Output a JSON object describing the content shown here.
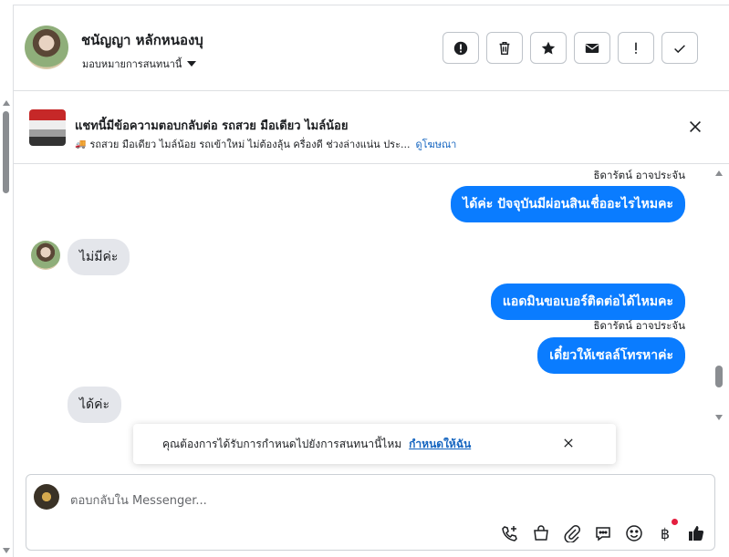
{
  "header": {
    "contact_name": "ชนัญญา หลักหนองบุ",
    "assign_label": "มอบหมายการสนทนานี้",
    "actions": [
      {
        "name": "spam-button",
        "icon": "alert-circle-icon"
      },
      {
        "name": "delete-button",
        "icon": "trash-icon"
      },
      {
        "name": "star-button",
        "icon": "star-icon"
      },
      {
        "name": "mark-unread-button",
        "icon": "envelope-icon"
      },
      {
        "name": "follow-up-button",
        "icon": "exclamation-icon"
      },
      {
        "name": "done-button",
        "icon": "check-icon"
      }
    ]
  },
  "ad": {
    "title": "แชทนี้มีข้อความตอบกลับต่อ รถสวย มือเดียว ไมล์น้อย",
    "description": "รถสวย มือเดียว ไมล์น้อย รถเข้าใหม่ ไม่ต้องลุ้น ครื่องดี ช่วงล่างแน่น ประ...",
    "link_label": "ดูโฆษณา"
  },
  "messages": {
    "sender_1": "ธิดารัตน์ อาจประจัน",
    "out_1": "ได้ค่ะ ปัจจุบันมีผ่อนสินเชื่ออะไรไหมคะ",
    "in_1": "ไม่มีค่ะ",
    "out_2": "แอดมินขอเบอร์ติดต่อได้ไหมคะ",
    "sender_2": "ธิดารัตน์ อาจประจัน",
    "out_3": "เดี๋ยวให้เซลล์โทรหาค่ะ",
    "in_2": "ได้ค่ะ"
  },
  "toast": {
    "text": "คุณต้องการได้รับการกำหนดไปยังการสนทนานี้ไหม",
    "link_label": "กำหนดให้ฉัน"
  },
  "composer": {
    "placeholder": "ตอบกลับใน Messenger...",
    "baht_symbol": "฿"
  },
  "colors": {
    "accent": "#0a7cff",
    "incoming_bubble": "#e4e6eb",
    "link": "#1565c0",
    "notification_dot": "#e41e3f"
  }
}
